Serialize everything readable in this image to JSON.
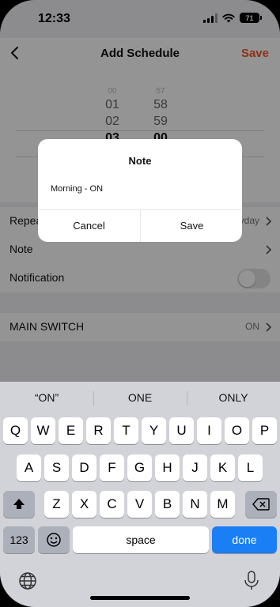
{
  "status_bar": {
    "time": "12:33",
    "battery": "71"
  },
  "nav": {
    "title": "Add Schedule",
    "save_label": "Save"
  },
  "time_picker": {
    "hours": [
      "00",
      "01",
      "02",
      "03"
    ],
    "minutes": [
      "57",
      "58",
      "59",
      "00"
    ]
  },
  "settings": {
    "repeat": {
      "label": "Repeat",
      "value": "Everyday"
    },
    "note": {
      "label": "Note"
    },
    "notification": {
      "label": "Notification",
      "enabled": false
    },
    "main_switch": {
      "label": "MAIN SWITCH",
      "value": "ON"
    }
  },
  "dialog": {
    "title": "Note",
    "input_value": "Morning - ON",
    "cancel_label": "Cancel",
    "save_label": "Save"
  },
  "keyboard": {
    "suggestions": [
      "“ON”",
      "ONE",
      "ONLY"
    ],
    "row1": [
      "Q",
      "W",
      "E",
      "R",
      "T",
      "Y",
      "U",
      "I",
      "O",
      "P"
    ],
    "row2": [
      "A",
      "S",
      "D",
      "F",
      "G",
      "H",
      "J",
      "K",
      "L"
    ],
    "row3": [
      "Z",
      "X",
      "C",
      "V",
      "B",
      "N",
      "M"
    ],
    "numbers_label": "123",
    "space_label": "space",
    "done_label": "done"
  },
  "colors": {
    "accent": "#f2572c",
    "done_key": "#1a7ef5"
  }
}
